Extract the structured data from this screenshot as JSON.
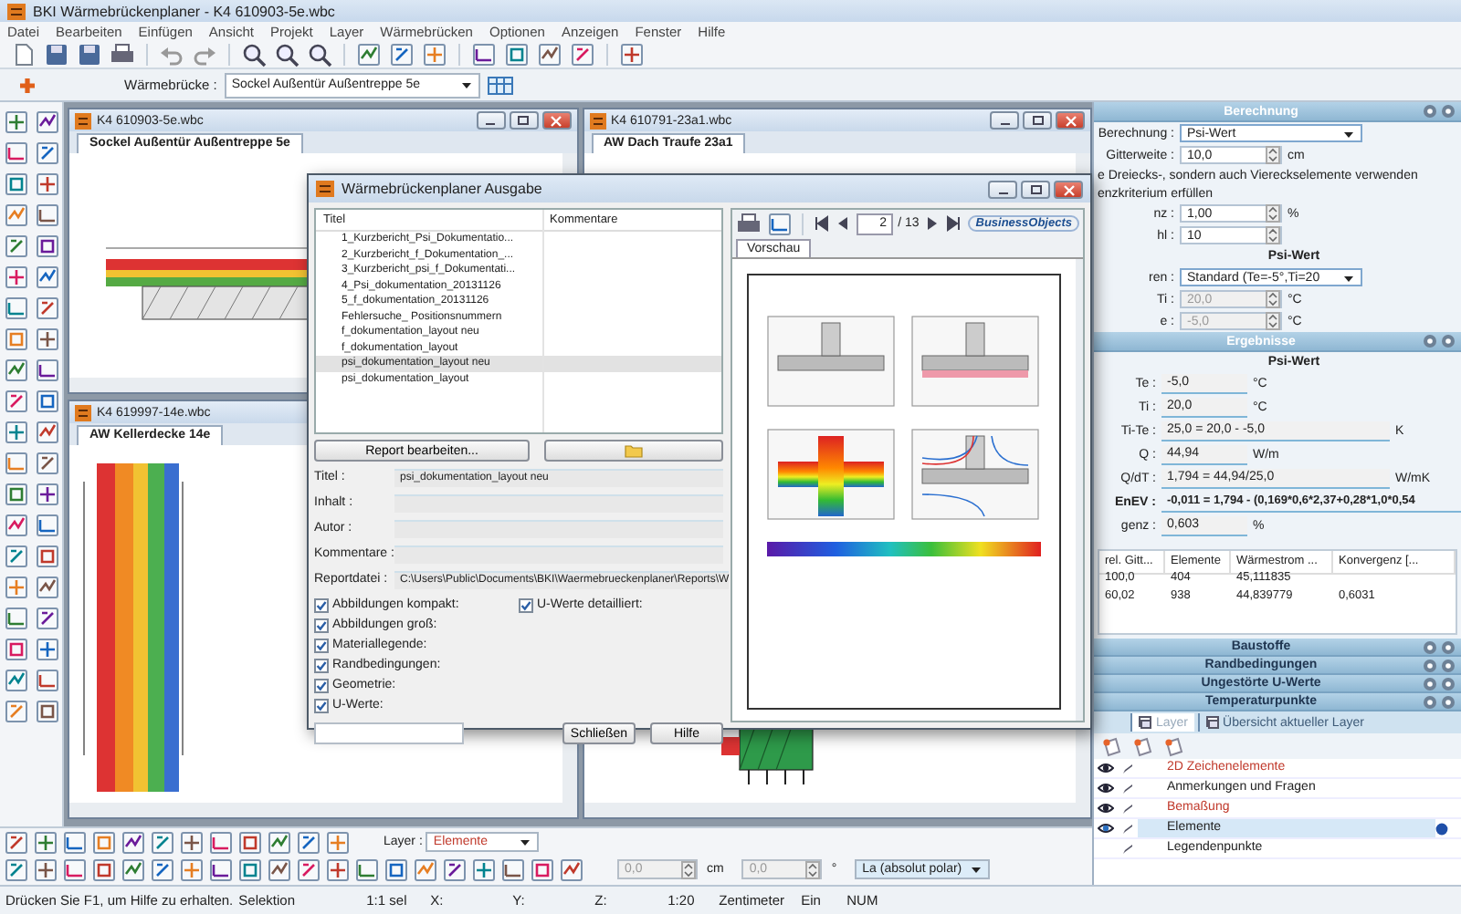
{
  "window": {
    "title": "BKI Wärmebrückenplaner - K4 610903-5e.wbc"
  },
  "menu": [
    "Datei",
    "Bearbeiten",
    "Einfügen",
    "Ansicht",
    "Projekt",
    "Layer",
    "Wärmebrücken",
    "Optionen",
    "Anzeigen",
    "Fenster",
    "Hilfe"
  ],
  "bridge_selector": {
    "label": "Wärmebrücke :",
    "value": "Sockel Außentür Außentreppe 5e"
  },
  "documents": [
    {
      "title": "K4 610903-5e.wbc",
      "tab": "Sockel Außentür Außentreppe 5e"
    },
    {
      "title": "K4 610791-23a1.wbc",
      "tab": "AW Dach Traufe 23a1"
    },
    {
      "title": "K4 619997-14e.wbc",
      "tab": "AW Kellerdecke 14e"
    }
  ],
  "dialog": {
    "title": "Wärmebrückenplaner Ausgabe",
    "columns": [
      "Titel",
      "Kommentare"
    ],
    "reports": [
      {
        "title": "1_Kurzbericht_Psi_Dokumentatio...",
        "selected": false
      },
      {
        "title": "2_Kurzbericht_f_Dokumentation_...",
        "selected": false
      },
      {
        "title": "3_Kurzbericht_psi_f_Dokumentati...",
        "selected": false
      },
      {
        "title": "4_Psi_dokumentation_20131126",
        "selected": false
      },
      {
        "title": "5_f_dokumentation_20131126",
        "selected": false
      },
      {
        "title": "Fehlersuche_ Positionsnummern",
        "selected": false
      },
      {
        "title": "f_dokumentation_layout neu",
        "selected": false
      },
      {
        "title": "f_dokumentation_layout",
        "selected": false
      },
      {
        "title": "psi_dokumentation_layout neu",
        "selected": true
      },
      {
        "title": "psi_dokumentation_layout",
        "selected": false
      }
    ],
    "edit_button": "Report bearbeiten...",
    "fields": [
      {
        "label": "Titel :",
        "value": "psi_dokumentation_layout neu"
      },
      {
        "label": "Inhalt :"
      },
      {
        "label": "Autor :"
      },
      {
        "label": "Kommentare :"
      },
      {
        "label": "Reportdatei :",
        "value": "C:\\Users\\Public\\Documents\\BKI\\Waermebrueckenplaner\\Reports\\W"
      }
    ],
    "option_columns": [
      [
        {
          "label": "Abbildungen kompakt:",
          "checked": true
        },
        {
          "label": "Abbildungen groß:",
          "checked": true
        },
        {
          "label": "Materiallegende:",
          "checked": true
        },
        {
          "label": "Randbedingungen:",
          "checked": true
        },
        {
          "label": "Geometrie:",
          "checked": true
        },
        {
          "label": "U-Werte:",
          "checked": true
        }
      ],
      [
        {
          "label": "U-Werte detailliert:",
          "checked": true
        }
      ]
    ],
    "buttons": [
      "Schließen",
      "Hilfe"
    ],
    "preview": {
      "page": "2",
      "page_count": "/ 13",
      "brand": "BusinessObjects",
      "tab": "Vorschau"
    }
  },
  "calculation": {
    "header": "Berechnung",
    "rows": [
      {
        "kind": "select",
        "label": "Berechnung :",
        "value": "Psi-Wert"
      },
      {
        "kind": "spin",
        "label": "Gitterweite :",
        "value": "10,0",
        "unit": "cm",
        "disabled": false
      },
      {
        "kind": "text",
        "text": "e Dreiecks-, sondern auch Viereckselemente verwenden"
      },
      {
        "kind": "text",
        "text": "enzkriterium erfüllen"
      },
      {
        "kind": "spin",
        "label": "nz :",
        "value": "1,00",
        "unit": "%",
        "disabled": false
      },
      {
        "kind": "spin",
        "label": "hl :",
        "value": "10",
        "disabled": false
      },
      {
        "kind": "heading",
        "text": "Psi-Wert"
      },
      {
        "kind": "select",
        "label": "ren :",
        "value": "Standard (Te=-5°,Ti=20"
      },
      {
        "kind": "spin",
        "label": "Ti :",
        "value": "20,0",
        "unit": "°C",
        "disabled": true
      },
      {
        "kind": "spin",
        "label": "e :",
        "value": "-5,0",
        "unit": "°C",
        "disabled": true
      }
    ]
  },
  "results": {
    "header": "Ergebnisse",
    "heading": "Psi-Wert",
    "rows": [
      {
        "kind": "value",
        "label": "Te :",
        "value": "-5,0",
        "unit": "°C"
      },
      {
        "kind": "value",
        "label": "Ti :",
        "value": "20,0",
        "unit": "°C"
      },
      {
        "kind": "formula",
        "label": "Ti-Te :",
        "value": "25,0 = 20,0 - -5,0",
        "unit": "K"
      },
      {
        "kind": "value",
        "label": "Q :",
        "value": "44,94",
        "unit": "W/m"
      },
      {
        "kind": "formula",
        "label": "Q/dT :",
        "value": "1,794 = 44,94/25,0",
        "unit": "W/mK"
      },
      {
        "kind": "total",
        "label": "EnEV :",
        "value": "-0,011 = 1,794 - (0,169*0,6*2,37+0,28*1,0*0,54"
      },
      {
        "kind": "value",
        "label": "genz :",
        "value": "0,603",
        "unit": "%"
      }
    ],
    "table": {
      "columns": [
        "rel. Gitt...",
        "Elemente",
        "Wärmestrom ...",
        "Konvergenz [..."
      ],
      "rows": [
        [
          "100,0",
          "404",
          "45,111835"
        ],
        [
          "60,02",
          "938",
          "44,839779",
          "0,6031"
        ]
      ]
    }
  },
  "sections": [
    "Baustoffe",
    "Randbedingungen",
    "Ungestörte U-Werte",
    "Temperaturpunkte"
  ],
  "layer_tabs": [
    {
      "label": "Layer",
      "selected": true
    },
    {
      "label": "Übersicht aktueller Layer",
      "selected": false
    }
  ],
  "layers": [
    {
      "name": "2D Zeichenelemente",
      "color": "#c0392b",
      "visible": true,
      "selected": false
    },
    {
      "name": "Anmerkungen und Fragen",
      "color": "#222222",
      "visible": true,
      "selected": false
    },
    {
      "name": "Bemaßung",
      "color": "#c0392b",
      "visible": true,
      "selected": false
    },
    {
      "name": "Elemente",
      "color": "#222222",
      "visible": true,
      "selected": true
    },
    {
      "name": "Legendenpunkte",
      "color": "#222222",
      "visible": false,
      "selected": false
    }
  ],
  "draw_toolbar": {
    "layer_label": "Layer :",
    "layer": "Elemente",
    "fields": [
      {
        "value": "0,0",
        "unit": "cm",
        "disabled": true
      },
      {
        "value": "0,0",
        "unit": "°",
        "disabled": true
      }
    ],
    "mode": "La (absolut polar)"
  },
  "status_bar": [
    "Drücken Sie F1, um Hilfe zu erhalten.",
    "Selektion",
    "1:1 sel",
    "X:",
    "Y:",
    "Z:",
    "1:20",
    "Zentimeter",
    "Ein",
    "NUM"
  ]
}
